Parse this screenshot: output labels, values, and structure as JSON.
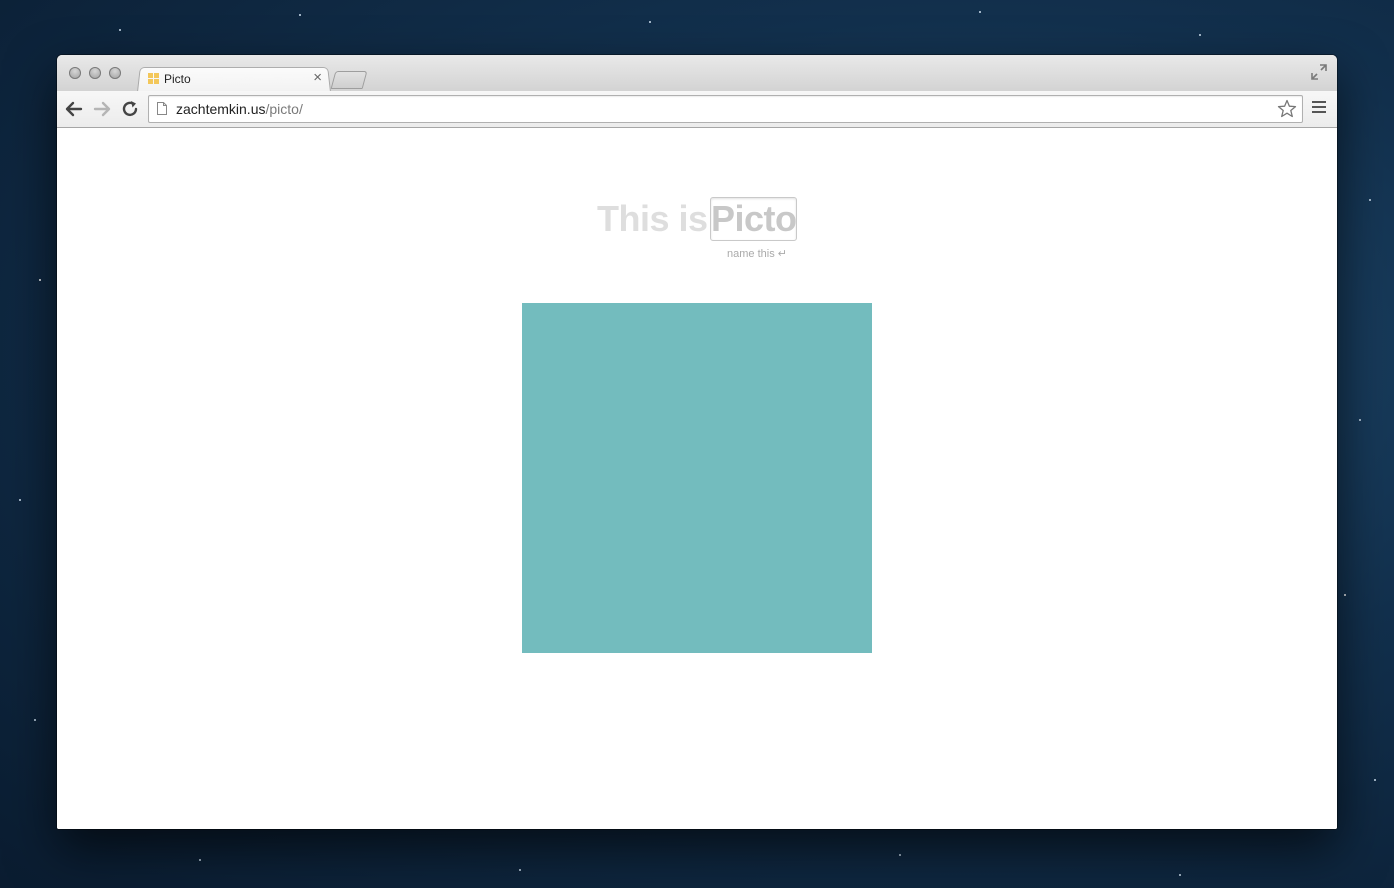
{
  "browser": {
    "tab": {
      "title": "Picto",
      "close_glyph": "×"
    },
    "omnibox": {
      "domain": "zachtemkin.us",
      "path": "/picto/"
    },
    "icons": {
      "back": "back-arrow-icon",
      "forward": "forward-arrow-icon",
      "reload": "reload-icon",
      "bookmark": "star-icon",
      "menu": "hamburger-menu-icon",
      "fullscreen": "fullscreen-icon",
      "page": "page-icon",
      "favicon": "picto-favicon-icon"
    }
  },
  "page": {
    "headline_prefix": "This is",
    "name_value": "Picto",
    "hint_text": "name this",
    "hint_glyph": "↵",
    "square_color": "#73bcbe"
  },
  "colors": {
    "favicon": "#f3c75a",
    "square": "#73bcbe"
  }
}
